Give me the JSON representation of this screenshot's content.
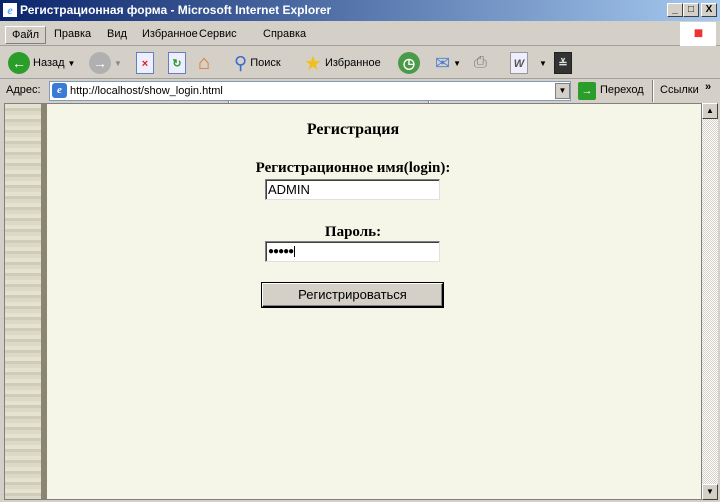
{
  "window": {
    "title": "Регистрационная форма - Microsoft Internet Explorer",
    "min": "_",
    "max": "□",
    "close": "X"
  },
  "menu": [
    "Файл",
    "Правка",
    "Вид",
    "Избранное",
    "Сервис",
    "Справка"
  ],
  "toolbar": {
    "back": "Назад",
    "search": "Поиск",
    "favorites": "Избранное"
  },
  "address": {
    "label": "Адрес:",
    "url": "http://localhost/show_login.html",
    "go": "Переход",
    "links": "Ссылки",
    "more": "»"
  },
  "page": {
    "heading": "Регистрация",
    "login_label": "Регистрационное имя(login):",
    "login_value": "ADMIN",
    "password_label": "Пароль:",
    "password_value": "●●●●●",
    "submit": "Регистрироваться"
  }
}
